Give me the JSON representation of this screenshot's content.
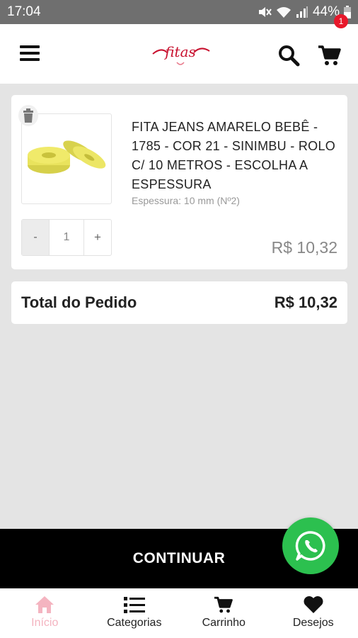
{
  "status_bar": {
    "time": "17:04",
    "battery": "44%"
  },
  "header": {
    "cart_count": "1",
    "logo_text": "Fitas"
  },
  "cart": {
    "items": [
      {
        "title": "FITA JEANS AMARELO BEBÊ - 1785 - COR 21 - SINIMBU - ROLO C/ 10 METROS - ESCOLHA A ESPESSURA",
        "variation": "Espessura: 10 mm (Nº2)",
        "quantity": "1",
        "minus_label": "-",
        "plus_label": "+",
        "price": "R$  10,32"
      }
    ],
    "total_label": "Total do Pedido",
    "total_value": "R$  10,32"
  },
  "continue_label": "CONTINUAR",
  "bottom_nav": [
    {
      "label": "Início",
      "icon": "home-icon",
      "active": true
    },
    {
      "label": "Categorias",
      "icon": "list-icon",
      "active": false
    },
    {
      "label": "Carrinho",
      "icon": "cart-icon",
      "active": false
    },
    {
      "label": "Desejos",
      "icon": "heart-icon",
      "active": false
    }
  ],
  "colors": {
    "accent": "#e8182b",
    "whatsapp": "#2cc04f",
    "nav_active": "#f4b4c0",
    "continue_bar": "#000000"
  }
}
